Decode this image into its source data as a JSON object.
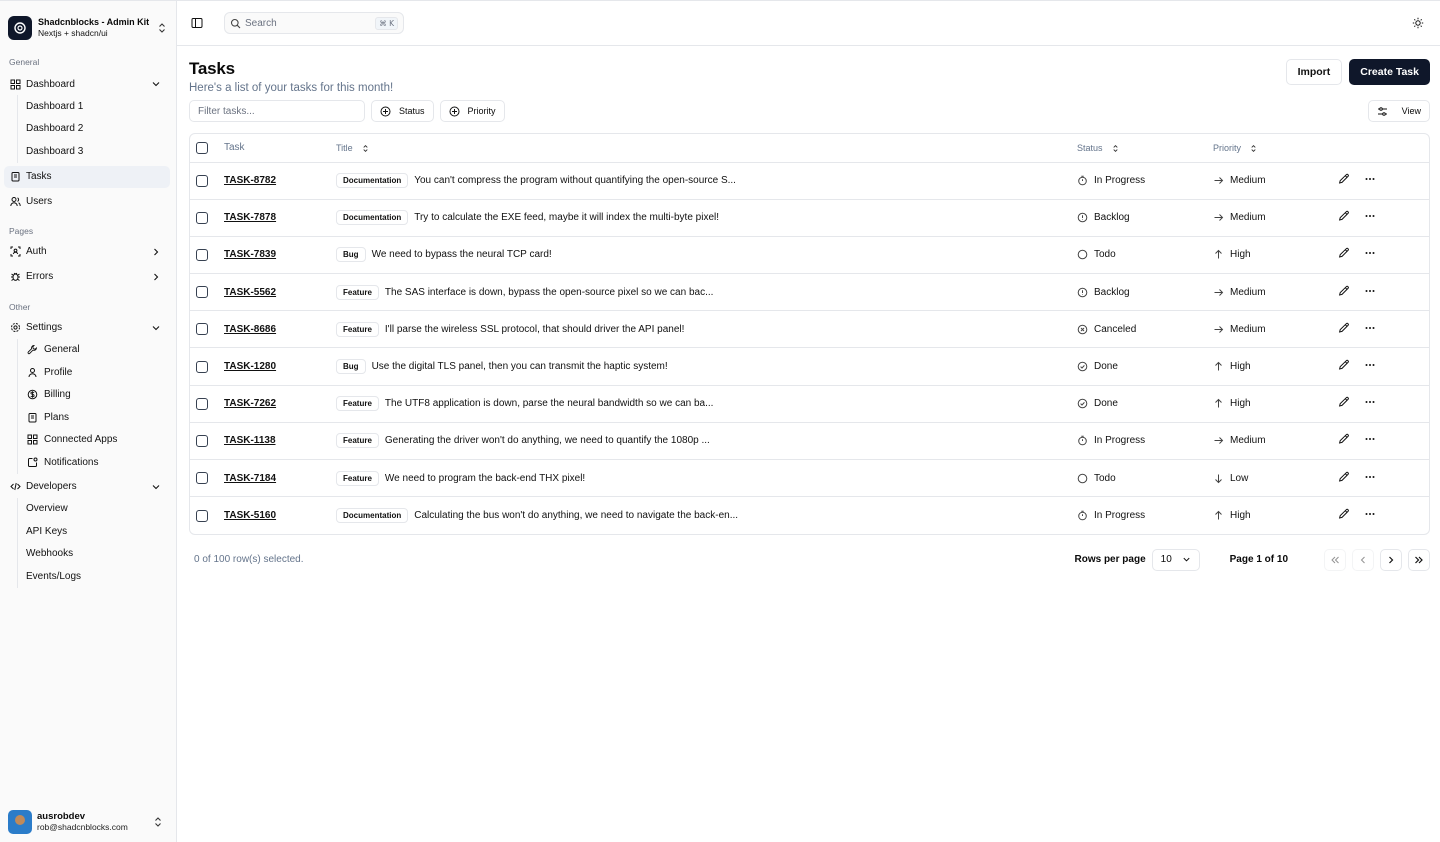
{
  "brand": {
    "title": "Shadcnblocks - Admin Kit",
    "subtitle": "Nextjs + shadcn/ui"
  },
  "sidebar": {
    "groups": {
      "general": "General",
      "pages": "Pages",
      "other": "Other"
    },
    "dashboard": {
      "label": "Dashboard",
      "children": [
        "Dashboard 1",
        "Dashboard 2",
        "Dashboard 3"
      ]
    },
    "tasks": "Tasks",
    "users": "Users",
    "auth": "Auth",
    "errors": "Errors",
    "settings": {
      "label": "Settings",
      "children": [
        "General",
        "Profile",
        "Billing",
        "Plans",
        "Connected Apps",
        "Notifications"
      ]
    },
    "developers": {
      "label": "Developers",
      "children": [
        "Overview",
        "API Keys",
        "Webhooks",
        "Events/Logs"
      ]
    }
  },
  "user": {
    "name": "ausrobdev",
    "email": "rob@shadcnblocks.com"
  },
  "search": {
    "placeholder": "Search",
    "shortcut": "⌘ K"
  },
  "page": {
    "title": "Tasks",
    "subtitle": "Here's a list of your tasks for this month!",
    "import_label": "Import",
    "create_label": "Create Task"
  },
  "toolbar": {
    "filter_placeholder": "Filter tasks...",
    "status_label": "Status",
    "priority_label": "Priority",
    "view_label": "View"
  },
  "table": {
    "headers": {
      "task": "Task",
      "title": "Title",
      "status": "Status",
      "priority": "Priority"
    },
    "rows": [
      {
        "id": "TASK-8782",
        "label": "Documentation",
        "title": "You can't compress the program without quantifying the open-source S...",
        "status": "In Progress",
        "priority": "Medium"
      },
      {
        "id": "TASK-7878",
        "label": "Documentation",
        "title": "Try to calculate the EXE feed, maybe it will index the multi-byte pixel!",
        "status": "Backlog",
        "priority": "Medium"
      },
      {
        "id": "TASK-7839",
        "label": "Bug",
        "title": "We need to bypass the neural TCP card!",
        "status": "Todo",
        "priority": "High"
      },
      {
        "id": "TASK-5562",
        "label": "Feature",
        "title": "The SAS interface is down, bypass the open-source pixel so we can bac...",
        "status": "Backlog",
        "priority": "Medium"
      },
      {
        "id": "TASK-8686",
        "label": "Feature",
        "title": "I'll parse the wireless SSL protocol, that should driver the API panel!",
        "status": "Canceled",
        "priority": "Medium"
      },
      {
        "id": "TASK-1280",
        "label": "Bug",
        "title": "Use the digital TLS panel, then you can transmit the haptic system!",
        "status": "Done",
        "priority": "High"
      },
      {
        "id": "TASK-7262",
        "label": "Feature",
        "title": "The UTF8 application is down, parse the neural bandwidth so we can ba...",
        "status": "Done",
        "priority": "High"
      },
      {
        "id": "TASK-1138",
        "label": "Feature",
        "title": "Generating the driver won't do anything, we need to quantify the 1080p ...",
        "status": "In Progress",
        "priority": "Medium"
      },
      {
        "id": "TASK-7184",
        "label": "Feature",
        "title": "We need to program the back-end THX pixel!",
        "status": "Todo",
        "priority": "Low"
      },
      {
        "id": "TASK-5160",
        "label": "Documentation",
        "title": "Calculating the bus won't do anything, we need to navigate the back-en...",
        "status": "In Progress",
        "priority": "High"
      }
    ]
  },
  "footer": {
    "selected_text": "0 of 100 row(s) selected.",
    "rows_per_page_label": "Rows per page",
    "rows_per_page_value": "10",
    "page_info": "Page 1 of 10"
  }
}
